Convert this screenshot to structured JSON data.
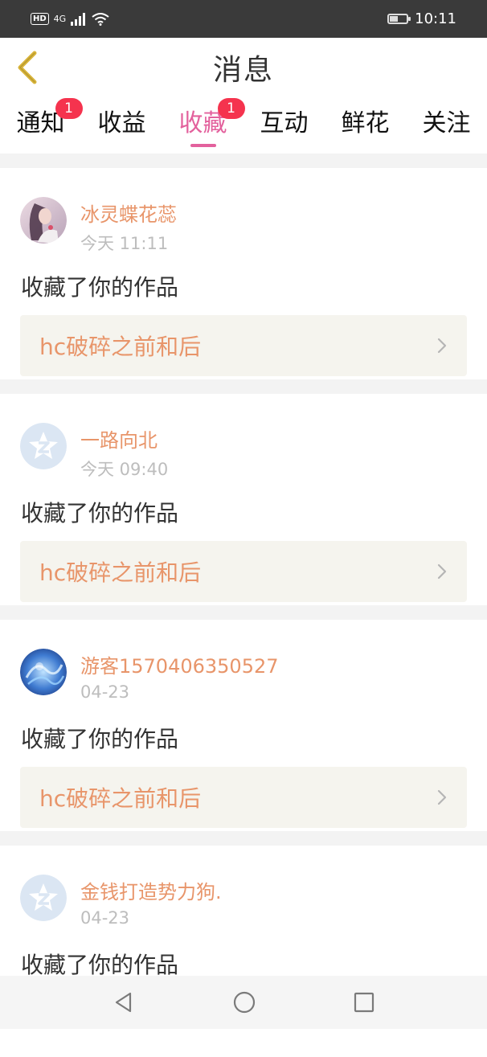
{
  "status_bar": {
    "network_label": "HD",
    "signal_label": "4G",
    "time": "10:11",
    "battery_fraction": 0.45
  },
  "header": {
    "title": "消息",
    "back_icon": "chevron-left-icon"
  },
  "tabs": [
    {
      "label": "通知",
      "badge": "1",
      "active": false
    },
    {
      "label": "收益",
      "badge": "",
      "active": false
    },
    {
      "label": "收藏",
      "badge": "1",
      "active": true
    },
    {
      "label": "互动",
      "badge": "",
      "active": false
    },
    {
      "label": "鲜花",
      "badge": "",
      "active": false
    },
    {
      "label": "关注",
      "badge": "",
      "active": false
    }
  ],
  "feed": [
    {
      "name": "冰灵蝶花蕊",
      "time": "今天 11:11",
      "action": "收藏了你的作品",
      "work": "hc破碎之前和后",
      "avatar": "portrait-avatar"
    },
    {
      "name": "一路向北",
      "time": "今天 09:40",
      "action": "收藏了你的作品",
      "work": "hc破碎之前和后",
      "avatar": "default-avatar"
    },
    {
      "name": "游客1570406350527",
      "time": "04-23",
      "action": "收藏了你的作品",
      "work": "hc破碎之前和后",
      "avatar": "blue-abstract-avatar"
    },
    {
      "name": "金钱打造势力狗.",
      "time": "04-23",
      "action": "收藏了你的作品",
      "work": "",
      "avatar": "default-avatar"
    }
  ],
  "colors": {
    "accent": "#e3619d",
    "username": "#e8956a",
    "badge": "#f5334e",
    "back_icon": "#d8b43a"
  },
  "nav_bar": {
    "icons": [
      "back-triangle-icon",
      "home-circle-icon",
      "recents-square-icon"
    ]
  }
}
